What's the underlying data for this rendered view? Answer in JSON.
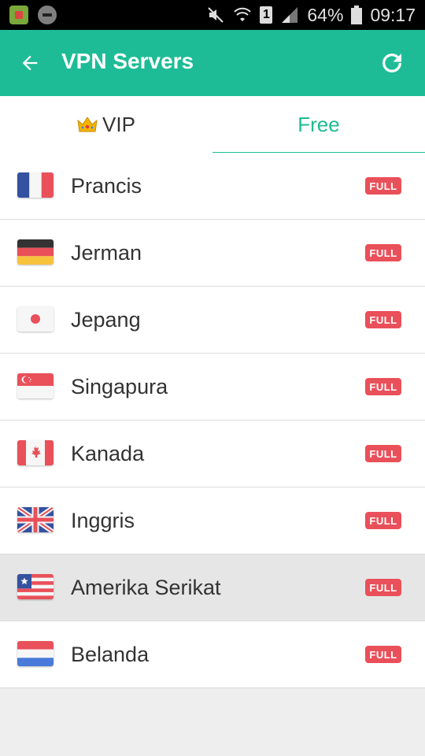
{
  "status_bar": {
    "sim": "1",
    "battery": "64%",
    "time": "09:17"
  },
  "app_bar": {
    "title": "VPN Servers"
  },
  "tabs": [
    {
      "label": "VIP"
    },
    {
      "label": "Free"
    }
  ],
  "servers": [
    {
      "name": "Prancis",
      "badge": "FULL",
      "flag": "france-flag-icon"
    },
    {
      "name": "Jerman",
      "badge": "FULL",
      "flag": "germany-flag-icon"
    },
    {
      "name": "Jepang",
      "badge": "FULL",
      "flag": "japan-flag-icon"
    },
    {
      "name": "Singapura",
      "badge": "FULL",
      "flag": "singapore-flag-icon"
    },
    {
      "name": "Kanada",
      "badge": "FULL",
      "flag": "canada-flag-icon"
    },
    {
      "name": "Inggris",
      "badge": "FULL",
      "flag": "uk-flag-icon"
    },
    {
      "name": "Amerika Serikat",
      "badge": "FULL",
      "flag": "usa-flag-icon"
    },
    {
      "name": "Belanda",
      "badge": "FULL",
      "flag": "netherlands-flag-icon"
    }
  ],
  "colors": {
    "accent": "#1dbc96",
    "badge": "#e9505a"
  }
}
